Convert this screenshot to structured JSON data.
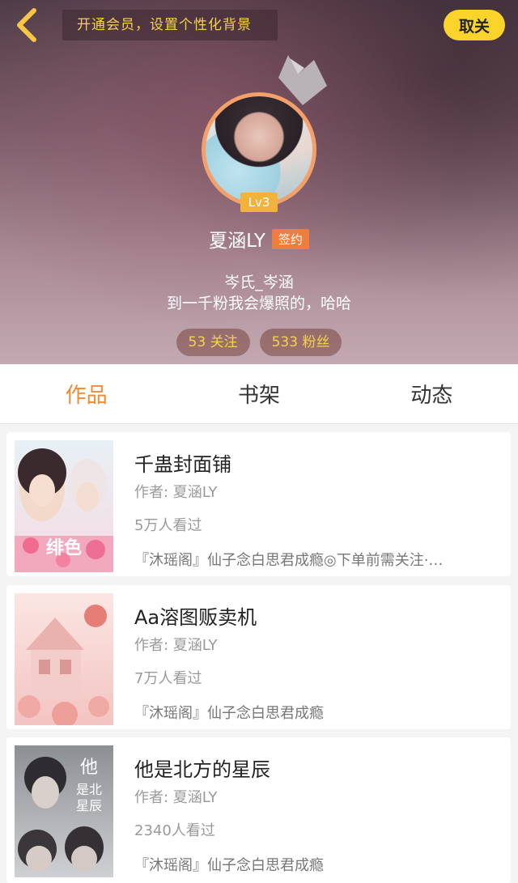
{
  "header": {
    "vip_banner": "开通会员，设置个性化背景",
    "unfollow_label": "取关",
    "level": "Lv3",
    "username": "夏涵LY",
    "sign_badge": "签约",
    "bio_line1": "岑氏_岑涵",
    "bio_line2": "到一千粉我会爆照的，哈哈",
    "following": "53 关注",
    "followers": "533 粉丝"
  },
  "tabs": [
    {
      "label": "作品",
      "active": true
    },
    {
      "label": "书架",
      "active": false
    },
    {
      "label": "动态",
      "active": false
    }
  ],
  "works": [
    {
      "title": "千蛊封面铺",
      "author": "作者: 夏涵LY",
      "views": "5万人看过",
      "desc": "『沐瑶阁』仙子念白思君成瘾◎下单前需关注·…"
    },
    {
      "title": "Aa溶图贩卖机",
      "author": "作者: 夏涵LY",
      "views": "7万人看过",
      "desc": "『沐瑶阁』仙子念白思君成瘾"
    },
    {
      "title": "他是北方的星辰",
      "author": "作者: 夏涵LY",
      "views": "2340人看过",
      "desc": "『沐瑶阁』仙子念白思君成瘾"
    }
  ],
  "icons": {
    "back": "chevron-left-icon",
    "crown": "crown-icon"
  },
  "colors": {
    "accent": "#f08a33",
    "unfollow_bg": "#fad32b",
    "vip_text": "#f5d24a",
    "sign_badge": "#ee7d3e",
    "level_badge": "#f3b23a"
  }
}
